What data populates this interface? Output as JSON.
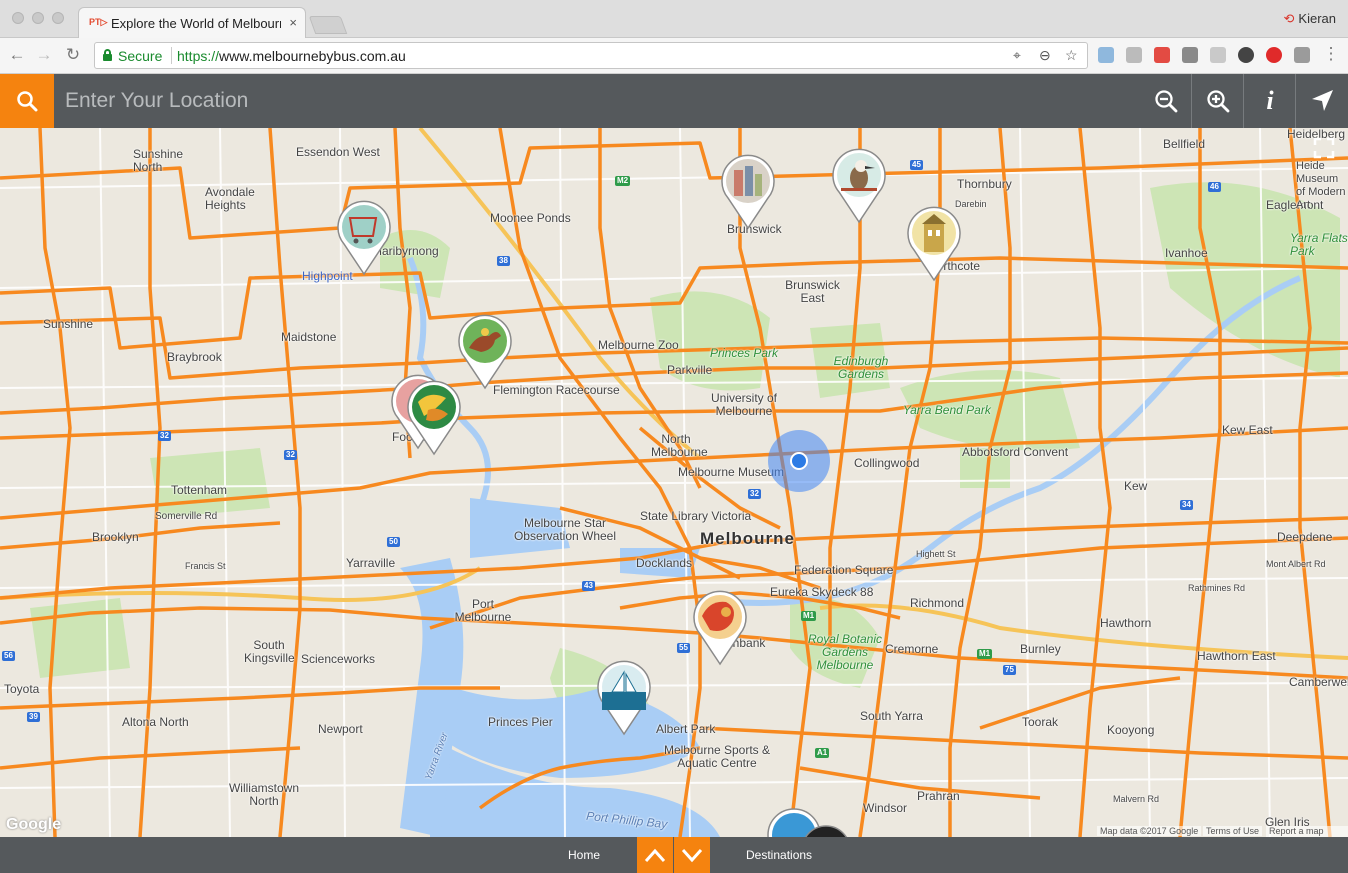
{
  "browser": {
    "tab_title": "Explore the World of Melbourne",
    "tab_favicon": "PT▷",
    "tab_close": "×",
    "profile_name": "Kieran",
    "secure_label": "Secure",
    "url_scheme": "https://",
    "url_host": "www.melbournebybus.com.au"
  },
  "appbar": {
    "location_placeholder": "Enter Your Location",
    "info_label": "i"
  },
  "map": {
    "places": [
      {
        "id": "essendon-west",
        "label": "Essendon West"
      },
      {
        "id": "sunshine-north",
        "label": "Sunshine North"
      },
      {
        "id": "avondale-heights",
        "label": "Avondale Heights"
      },
      {
        "id": "moonee-ponds",
        "label": "Moonee Ponds"
      },
      {
        "id": "maribyrnong",
        "label": "Maribyrnong"
      },
      {
        "id": "highpoint",
        "label": "Highpoint"
      },
      {
        "id": "sunshine",
        "label": "Sunshine"
      },
      {
        "id": "maidstone",
        "label": "Maidstone"
      },
      {
        "id": "braybrook",
        "label": "Braybrook"
      },
      {
        "id": "flemington-racecourse",
        "label": "Flemington Racecourse"
      },
      {
        "id": "melbourne-zoo",
        "label": "Melbourne Zoo"
      },
      {
        "id": "princes-park",
        "label": "Princes Park"
      },
      {
        "id": "parkville",
        "label": "Parkville"
      },
      {
        "id": "university-of-melbourne",
        "label": "University of Melbourne"
      },
      {
        "id": "north-melbourne",
        "label": "North Melbourne"
      },
      {
        "id": "melbourne-museum",
        "label": "Melbourne Museum"
      },
      {
        "id": "brunswick",
        "label": "Brunswick"
      },
      {
        "id": "brunswick-east",
        "label": "Brunswick East"
      },
      {
        "id": "northcote",
        "label": "Northcote"
      },
      {
        "id": "thornbury",
        "label": "Thornbury"
      },
      {
        "id": "darebin",
        "label": "Darebin"
      },
      {
        "id": "edinburgh-gardens",
        "label": "Edinburgh Gardens"
      },
      {
        "id": "yarra-bend-park",
        "label": "Yarra Bend Park"
      },
      {
        "id": "abbotsford-convent",
        "label": "Abbotsford Convent"
      },
      {
        "id": "collingwood",
        "label": "Collingwood"
      },
      {
        "id": "heidelberg",
        "label": "Heidelberg"
      },
      {
        "id": "bellfield",
        "label": "Bellfield"
      },
      {
        "id": "ivanhoe",
        "label": "Ivanhoe"
      },
      {
        "id": "eaglemont",
        "label": "Eaglemont"
      },
      {
        "id": "yarra-flats-park",
        "label": "Yarra Flats Park"
      },
      {
        "id": "kew-east",
        "label": "Kew East"
      },
      {
        "id": "kew",
        "label": "Kew"
      },
      {
        "id": "tottenham",
        "label": "Tottenham"
      },
      {
        "id": "somerville-rd",
        "label": "Somerville Rd"
      },
      {
        "id": "brooklyn",
        "label": "Brooklyn"
      },
      {
        "id": "yarraville",
        "label": "Yarraville"
      },
      {
        "id": "footscray",
        "label": "Footscray"
      },
      {
        "id": "melbourne-star",
        "label": "Melbourne Star Observation Wheel"
      },
      {
        "id": "state-library",
        "label": "State Library Victoria"
      },
      {
        "id": "melbourne",
        "label": "Melbourne"
      },
      {
        "id": "docklands",
        "label": "Docklands"
      },
      {
        "id": "federation-square",
        "label": "Federation Square"
      },
      {
        "id": "eureka-skydeck",
        "label": "Eureka Skydeck 88"
      },
      {
        "id": "richmond",
        "label": "Richmond"
      },
      {
        "id": "port-melbourne",
        "label": "Port Melbourne"
      },
      {
        "id": "south-kingsville",
        "label": "South Kingsville"
      },
      {
        "id": "scienceworks",
        "label": "Scienceworks"
      },
      {
        "id": "royal-botanic-gardens",
        "label": "Royal Botanic Gardens Melbourne"
      },
      {
        "id": "cremorne",
        "label": "Cremorne"
      },
      {
        "id": "burnley",
        "label": "Burnley"
      },
      {
        "id": "hawthorn",
        "label": "Hawthorn"
      },
      {
        "id": "hawthorn-east",
        "label": "Hawthorn East"
      },
      {
        "id": "deepdene",
        "label": "Deepdene"
      },
      {
        "id": "camberwell",
        "label": "Camberwell"
      },
      {
        "id": "toyota",
        "label": "Toyota"
      },
      {
        "id": "altona-north",
        "label": "Altona North"
      },
      {
        "id": "newport",
        "label": "Newport"
      },
      {
        "id": "williamstown-north",
        "label": "Williamstown North"
      },
      {
        "id": "princes-pier",
        "label": "Princes Pier"
      },
      {
        "id": "albert-park",
        "label": "Albert Park"
      },
      {
        "id": "melbourne-sports",
        "label": "Melbourne Sports & Aquatic Centre"
      },
      {
        "id": "south-yarra",
        "label": "South Yarra"
      },
      {
        "id": "toorak",
        "label": "Toorak"
      },
      {
        "id": "kooyong",
        "label": "Kooyong"
      },
      {
        "id": "prahran",
        "label": "Prahran"
      },
      {
        "id": "windsor",
        "label": "Windsor"
      },
      {
        "id": "glen-iris",
        "label": "Glen Iris"
      },
      {
        "id": "malvern-rd",
        "label": "Malvern Rd"
      },
      {
        "id": "port-phillip-bay",
        "label": "Port Phillip Bay"
      },
      {
        "id": "yarra-river",
        "label": "Yarra River"
      },
      {
        "id": "southbank",
        "label": "Southbank"
      },
      {
        "id": "highett-st",
        "label": "Highett St"
      },
      {
        "id": "rathmines-rd",
        "label": "Rathmines Rd"
      },
      {
        "id": "mont-albert-rd",
        "label": "Mont Albert Rd"
      },
      {
        "id": "francis-st",
        "label": "Francis St"
      },
      {
        "id": "princes-pier",
        "label": "Princes Pier"
      },
      {
        "id": "heide",
        "label": "Heide Museum of Modern Art"
      }
    ],
    "google_logo": "Google",
    "attribution": [
      "Map data ©2017 Google",
      "Terms of Use",
      "Report a map error"
    ]
  },
  "pins": [
    {
      "name": "highpoint-shopping-pin",
      "color": "#9fd0c7"
    },
    {
      "name": "brunswick-pin",
      "color": "#d9d2c8"
    },
    {
      "name": "kookaburra-pin",
      "color": "#d7ebe6"
    },
    {
      "name": "northcote-pin",
      "color": "#f1e3a6"
    },
    {
      "name": "flemington-horse-pin",
      "color": "#6fb35a"
    },
    {
      "name": "footscray-market-pin",
      "color": "#2e8a44"
    },
    {
      "name": "southbank-food-pin",
      "color": "#d9452b"
    },
    {
      "name": "sailing-pin",
      "color": "#1d6f93"
    }
  ],
  "bottombar": {
    "home_label": "Home",
    "destinations_label": "Destinations"
  },
  "colors": {
    "accent": "#f5830f",
    "bar": "#55595c",
    "bus_route": "#f7891f",
    "water": "#a9cdf5",
    "park": "#cde5b5"
  }
}
